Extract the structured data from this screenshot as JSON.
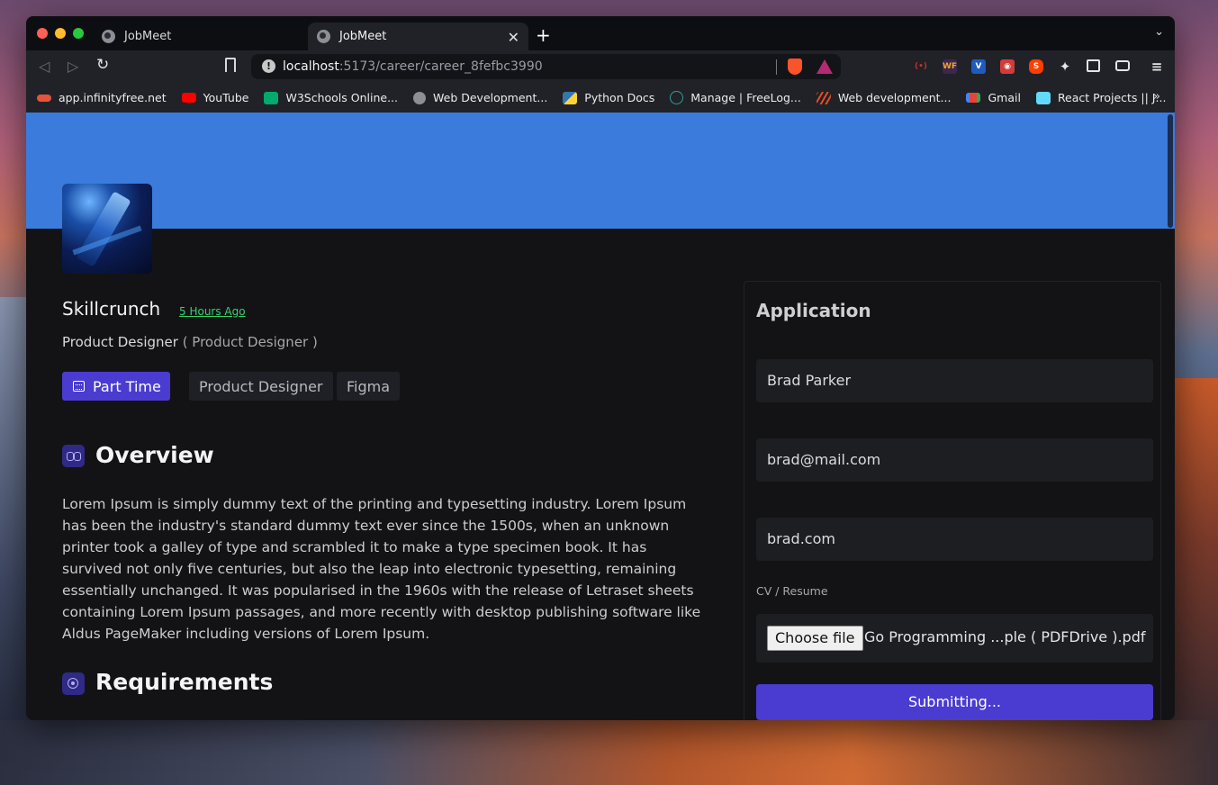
{
  "browser": {
    "tabs": [
      {
        "title": "JobMeet",
        "active": false
      },
      {
        "title": "JobMeet",
        "active": true
      }
    ],
    "tab_close": "✕",
    "new_tab": "+",
    "tab_menu": "⌄",
    "url_host": "localhost",
    "url_path": ":5173/career/career_8fefbc3990",
    "bookmarks": [
      {
        "label": "app.infinityfree.net",
        "icon": "infinity-icon",
        "color": "#e5533c"
      },
      {
        "label": "YouTube",
        "icon": "youtube-icon",
        "color": "#ff0000"
      },
      {
        "label": "W3Schools Online...",
        "icon": "w3schools-icon",
        "color": "#04aa6d"
      },
      {
        "label": "Web Development...",
        "icon": "globe-icon",
        "color": "#8c8f96"
      },
      {
        "label": "Python Docs",
        "icon": "python-icon",
        "color": "#3776ab"
      },
      {
        "label": "Manage | FreeLog...",
        "icon": "freelogo-icon",
        "color": "#2aa198"
      },
      {
        "label": "Web development...",
        "icon": "stripes-icon",
        "color": "#e34c26"
      },
      {
        "label": "Gmail",
        "icon": "gmail-icon",
        "color": "#ea4335"
      },
      {
        "label": "React Projects || J...",
        "icon": "react-r-icon",
        "color": "#61dafb"
      }
    ],
    "bookmarks_more": "»"
  },
  "job": {
    "company": "Skillcrunch",
    "posted": "5 Hours Ago",
    "role": "Product Designer",
    "role_sub": "( Product Designer )",
    "job_type": "Part Time",
    "tags": [
      "Product Designer",
      "Figma"
    ],
    "overview_title": "Overview",
    "overview_text": "Lorem Ipsum is simply dummy text of the printing and typesetting industry. Lorem Ipsum has been the industry's standard dummy text ever since the 1500s, when an unknown printer took a galley of type and scrambled it to make a type specimen book. It has survived not only five centuries, but also the leap into electronic typesetting, remaining essentially unchanged. It was popularised in the 1960s with the release of Letraset sheets containing Lorem Ipsum passages, and more recently with desktop publishing software like Aldus PageMaker including versions of Lorem Ipsum.",
    "requirements_title": "Requirements"
  },
  "application": {
    "title": "Application",
    "name_value": "Brad Parker",
    "email_value": "brad@mail.com",
    "website_value": "brad.com",
    "cv_label": "CV / Resume",
    "file_button": "Choose file",
    "file_name": "Go Programming ...ple ( PDFDrive ).pdf",
    "submit_label": "Submitting..."
  },
  "colors": {
    "banner": "#3a7bdc",
    "primary": "#4a3cd0",
    "posted_link": "#36d26b"
  }
}
